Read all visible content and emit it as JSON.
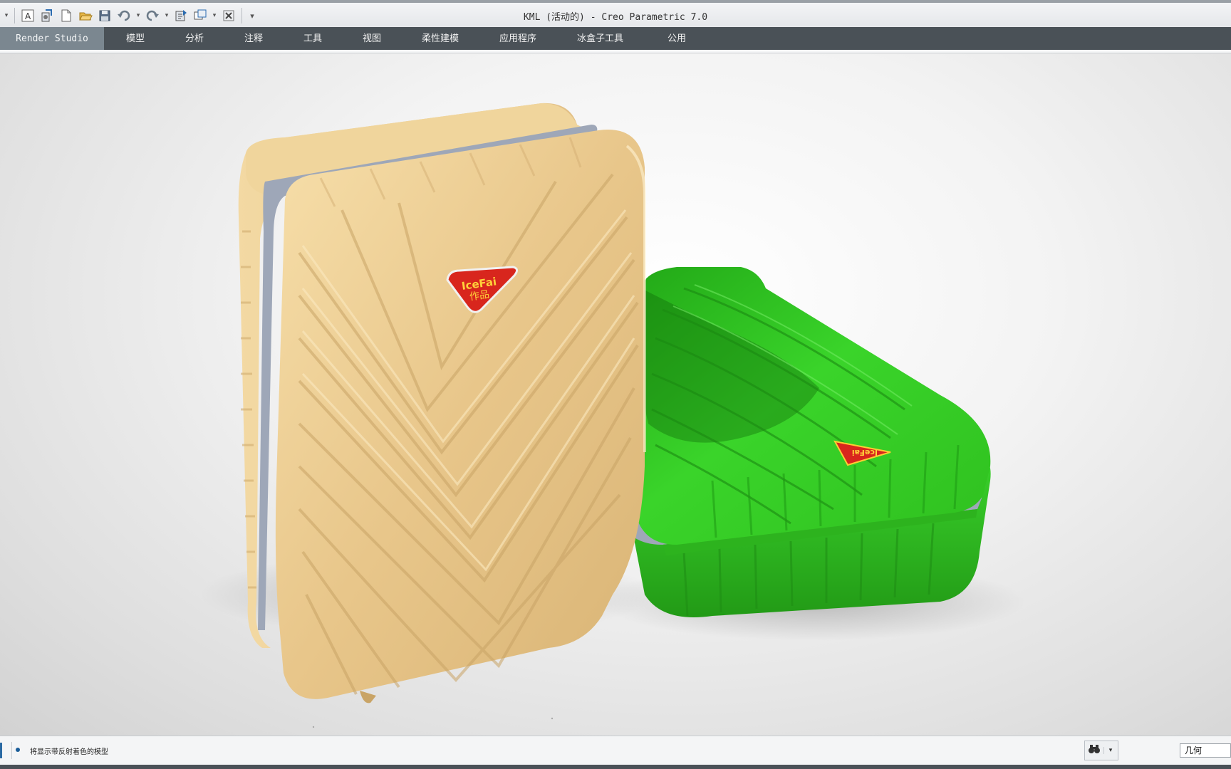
{
  "window": {
    "title": "KML (活动的) - Creo Parametric 7.0"
  },
  "quick_access": [
    {
      "icon": "text-style-icon"
    },
    {
      "icon": "regenerate-icon"
    },
    {
      "icon": "new-file-icon"
    },
    {
      "icon": "open-file-icon"
    },
    {
      "icon": "save-icon"
    },
    {
      "icon": "undo-icon"
    },
    {
      "icon": "redo-icon"
    },
    {
      "icon": "regenerate-model-icon"
    },
    {
      "icon": "windows-icon"
    },
    {
      "icon": "close-window-icon"
    },
    {
      "icon": "customize-toolbar-icon"
    }
  ],
  "ribbon": {
    "tabs": [
      {
        "label": "Render Studio",
        "active": true
      },
      {
        "label": "模型"
      },
      {
        "label": "分析"
      },
      {
        "label": "注释"
      },
      {
        "label": "工具"
      },
      {
        "label": "视图"
      },
      {
        "label": "柔性建模"
      },
      {
        "label": "应用程序"
      },
      {
        "label": "冰盒子工具"
      },
      {
        "label": "公用"
      }
    ]
  },
  "viewport": {
    "badge_text_main": "IceFai",
    "badge_text_sub": "作品",
    "colors": {
      "tan_case": "#e9c98e",
      "green_case": "#2fc41f",
      "stripe": "#9ea7b8",
      "badge": "#d8261d"
    }
  },
  "status": {
    "message": "将显示带反射着色的模型",
    "filter_value": "几何"
  }
}
